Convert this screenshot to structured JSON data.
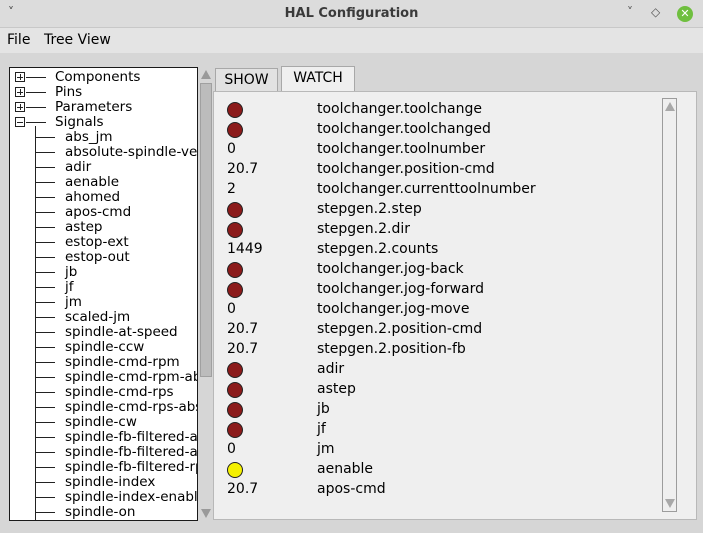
{
  "window": {
    "title": "HAL Configuration",
    "menu_glyph": "˅",
    "min_glyph": "˅",
    "max_glyph": "◇",
    "close_glyph": "✕"
  },
  "menu": {
    "file": "File",
    "tree_view": "Tree View"
  },
  "tree": {
    "top_nodes": [
      "Components",
      "Pins",
      "Parameters",
      "Signals"
    ],
    "signals": [
      "abs_jm",
      "absolute-spindle-vel",
      "adir",
      "aenable",
      "ahomed",
      "apos-cmd",
      "astep",
      "estop-ext",
      "estop-out",
      "jb",
      "jf",
      "jm",
      "scaled-jm",
      "spindle-at-speed",
      "spindle-ccw",
      "spindle-cmd-rpm",
      "spindle-cmd-rpm-abs",
      "spindle-cmd-rps",
      "spindle-cmd-rps-abs",
      "spindle-cw",
      "spindle-fb-filtered-abs",
      "spindle-fb-filtered-a",
      "spindle-fb-filtered-rps",
      "spindle-index",
      "spindle-index-enable",
      "spindle-on"
    ]
  },
  "tabs": {
    "show": "SHOW",
    "watch": "WATCH"
  },
  "colors": {
    "led_off": "#8b1a1a",
    "led_on": "#f4f000"
  },
  "watch": [
    {
      "kind": "led",
      "state": "off",
      "name": "toolchanger.toolchange"
    },
    {
      "kind": "led",
      "state": "off",
      "name": "toolchanger.toolchanged"
    },
    {
      "kind": "value",
      "value": "0",
      "name": "toolchanger.toolnumber"
    },
    {
      "kind": "value",
      "value": "20.7",
      "name": "toolchanger.position-cmd"
    },
    {
      "kind": "value",
      "value": "2",
      "name": "toolchanger.currenttoolnumber"
    },
    {
      "kind": "led",
      "state": "off",
      "name": "stepgen.2.step"
    },
    {
      "kind": "led",
      "state": "off",
      "name": "stepgen.2.dir"
    },
    {
      "kind": "value",
      "value": "1449",
      "name": "stepgen.2.counts"
    },
    {
      "kind": "led",
      "state": "off",
      "name": "toolchanger.jog-back"
    },
    {
      "kind": "led",
      "state": "off",
      "name": "toolchanger.jog-forward"
    },
    {
      "kind": "value",
      "value": "0",
      "name": "toolchanger.jog-move"
    },
    {
      "kind": "value",
      "value": "20.7",
      "name": "stepgen.2.position-cmd"
    },
    {
      "kind": "value",
      "value": "20.7",
      "name": "stepgen.2.position-fb"
    },
    {
      "kind": "led",
      "state": "off",
      "name": "adir"
    },
    {
      "kind": "led",
      "state": "off",
      "name": "astep"
    },
    {
      "kind": "led",
      "state": "off",
      "name": "jb"
    },
    {
      "kind": "led",
      "state": "off",
      "name": "jf"
    },
    {
      "kind": "value",
      "value": "0",
      "name": "jm"
    },
    {
      "kind": "led",
      "state": "on",
      "name": "aenable"
    },
    {
      "kind": "value",
      "value": "20.7",
      "name": "apos-cmd"
    }
  ]
}
